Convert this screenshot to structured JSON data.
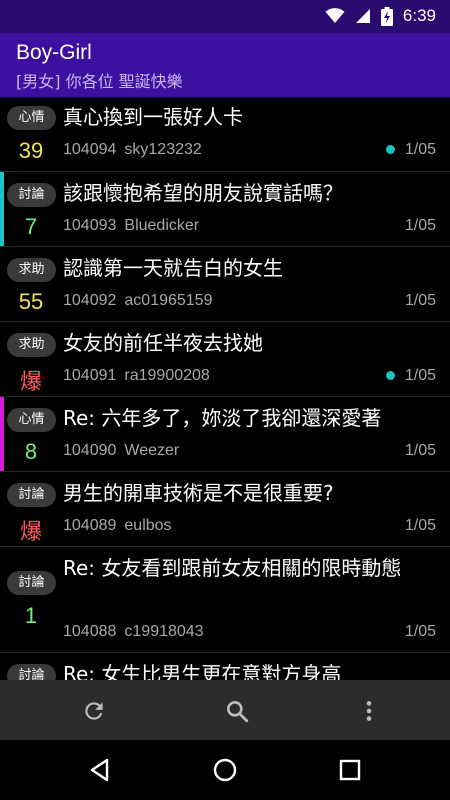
{
  "status_bar": {
    "time": "6:39",
    "icons": [
      "wifi-icon",
      "signal-icon",
      "battery-charging-icon"
    ]
  },
  "app_bar": {
    "title": "Boy-Girl",
    "subtitle": "[男女] 你各位 聖誕快樂"
  },
  "colors": {
    "status_bar_bg": "#2a0a6e",
    "app_bar_bg": "#3d10a0",
    "count_yellow": "#f2e25a",
    "count_green": "#6ef07a",
    "count_red": "#ff5a5a",
    "accent_cyan": "#1fc2c2",
    "accent_magenta": "#d81bd8",
    "unread_dot": "#1fc2c2"
  },
  "posts": [
    {
      "tag": "心情",
      "count": "39",
      "count_color": "#f2e25a",
      "accent": "",
      "title": "真心換到一張好人卡",
      "aid": "104094",
      "author": "sky123232",
      "unread": true,
      "date": "1/05"
    },
    {
      "tag": "討論",
      "count": "7",
      "count_color": "#6ef07a",
      "accent": "#1fc2c2",
      "title": "該跟懷抱希望的朋友說實話嗎？",
      "aid": "104093",
      "author": "Bluedicker",
      "unread": false,
      "date": "1/05"
    },
    {
      "tag": "求助",
      "count": "55",
      "count_color": "#f2e25a",
      "accent": "",
      "title": "認識第一天就告白的女生",
      "aid": "104092",
      "author": "ac01965159",
      "unread": false,
      "date": "1/05"
    },
    {
      "tag": "求助",
      "count": "爆",
      "count_color": "#ff5a5a",
      "accent": "",
      "title": "女友的前任半夜去找她",
      "aid": "104091",
      "author": "ra19900208",
      "unread": true,
      "date": "1/05"
    },
    {
      "tag": "心情",
      "count": "8",
      "count_color": "#6ef07a",
      "accent": "#d81bd8",
      "title": "Re: 六年多了，妳淡了我卻還深愛著",
      "aid": "104090",
      "author": "Weezer",
      "unread": false,
      "date": "1/05"
    },
    {
      "tag": "討論",
      "count": "爆",
      "count_color": "#ff5a5a",
      "accent": "",
      "title": "男生的開車技術是不是很重要?",
      "aid": "104089",
      "author": "eulbos",
      "unread": false,
      "date": "1/05"
    },
    {
      "tag": "討論",
      "count": "1",
      "count_color": "#6ef07a",
      "accent": "",
      "title": "Re: 女友看到跟前女友相關的限時動態",
      "aid": "104088",
      "author": "c19918043",
      "unread": false,
      "date": "1/05"
    },
    {
      "tag": "討論",
      "count": "",
      "count_color": "#6ef07a",
      "accent": "",
      "title": "Re: 女生比男生更在意對方身高",
      "aid": "",
      "author": "",
      "unread": false,
      "date": ""
    }
  ],
  "toolbar": {
    "buttons": [
      "refresh-icon",
      "search-icon",
      "more-vert-icon"
    ]
  },
  "nav_bar": {
    "buttons": [
      "back-icon",
      "home-icon",
      "recents-icon"
    ]
  }
}
